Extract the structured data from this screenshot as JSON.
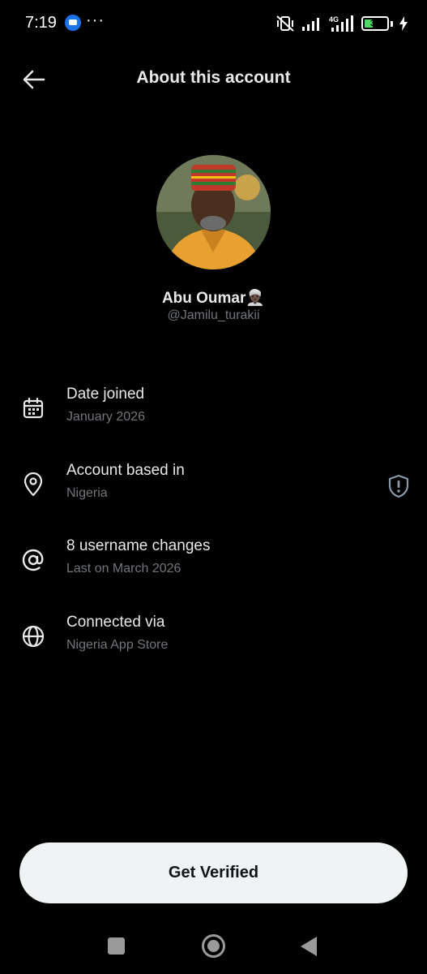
{
  "status_bar": {
    "time": "7:19",
    "more": "···",
    "network": "4G",
    "battery": "38",
    "battery_level": 0.38
  },
  "header": {
    "title": "About this account"
  },
  "profile": {
    "name": "Abu Oumar",
    "name_emoji": "👳🏿‍♂️",
    "handle": "@Jamilu_turakii"
  },
  "rows": [
    {
      "icon": "calendar-icon",
      "title": "Date joined",
      "subtitle": "January 2026"
    },
    {
      "icon": "location-pin-icon",
      "title": "Account based in",
      "subtitle": "Nigeria",
      "trailing_icon": "shield-alert-icon"
    },
    {
      "icon": "at-sign-icon",
      "title": "8 username changes",
      "subtitle": "Last on March 2026"
    },
    {
      "icon": "globe-icon",
      "title": "Connected via",
      "subtitle": "Nigeria App Store"
    }
  ],
  "cta": {
    "label": "Get Verified"
  },
  "colors": {
    "background": "#000000",
    "primary_text": "#e7e9ea",
    "secondary_text": "#71767b",
    "cta_background": "#eff3f4",
    "cta_text": "#0f1419"
  }
}
